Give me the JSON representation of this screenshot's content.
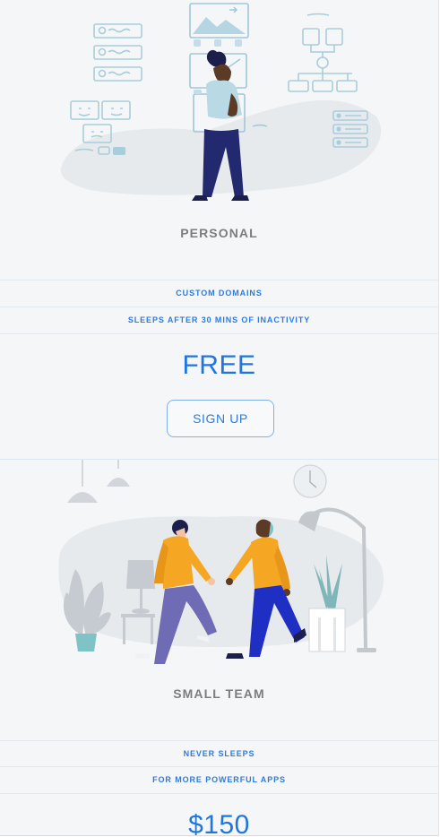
{
  "plans": [
    {
      "name": "PERSONAL",
      "features": [
        "CUSTOM DOMAINS",
        "SLEEPS AFTER 30 MINS OF INACTIVITY"
      ],
      "price": "FREE",
      "cta": "SIGN UP"
    },
    {
      "name": "SMALL TEAM",
      "features": [
        "NEVER SLEEPS",
        "FOR MORE POWERFUL APPS"
      ],
      "price": "$150"
    }
  ],
  "colors": {
    "accent": "#1f76e0",
    "title_gray": "#7b7d80",
    "card_bg": "#f5f6f7",
    "jacket_orange": "#f5a623",
    "sketch_blue": "#9fc6d8"
  }
}
